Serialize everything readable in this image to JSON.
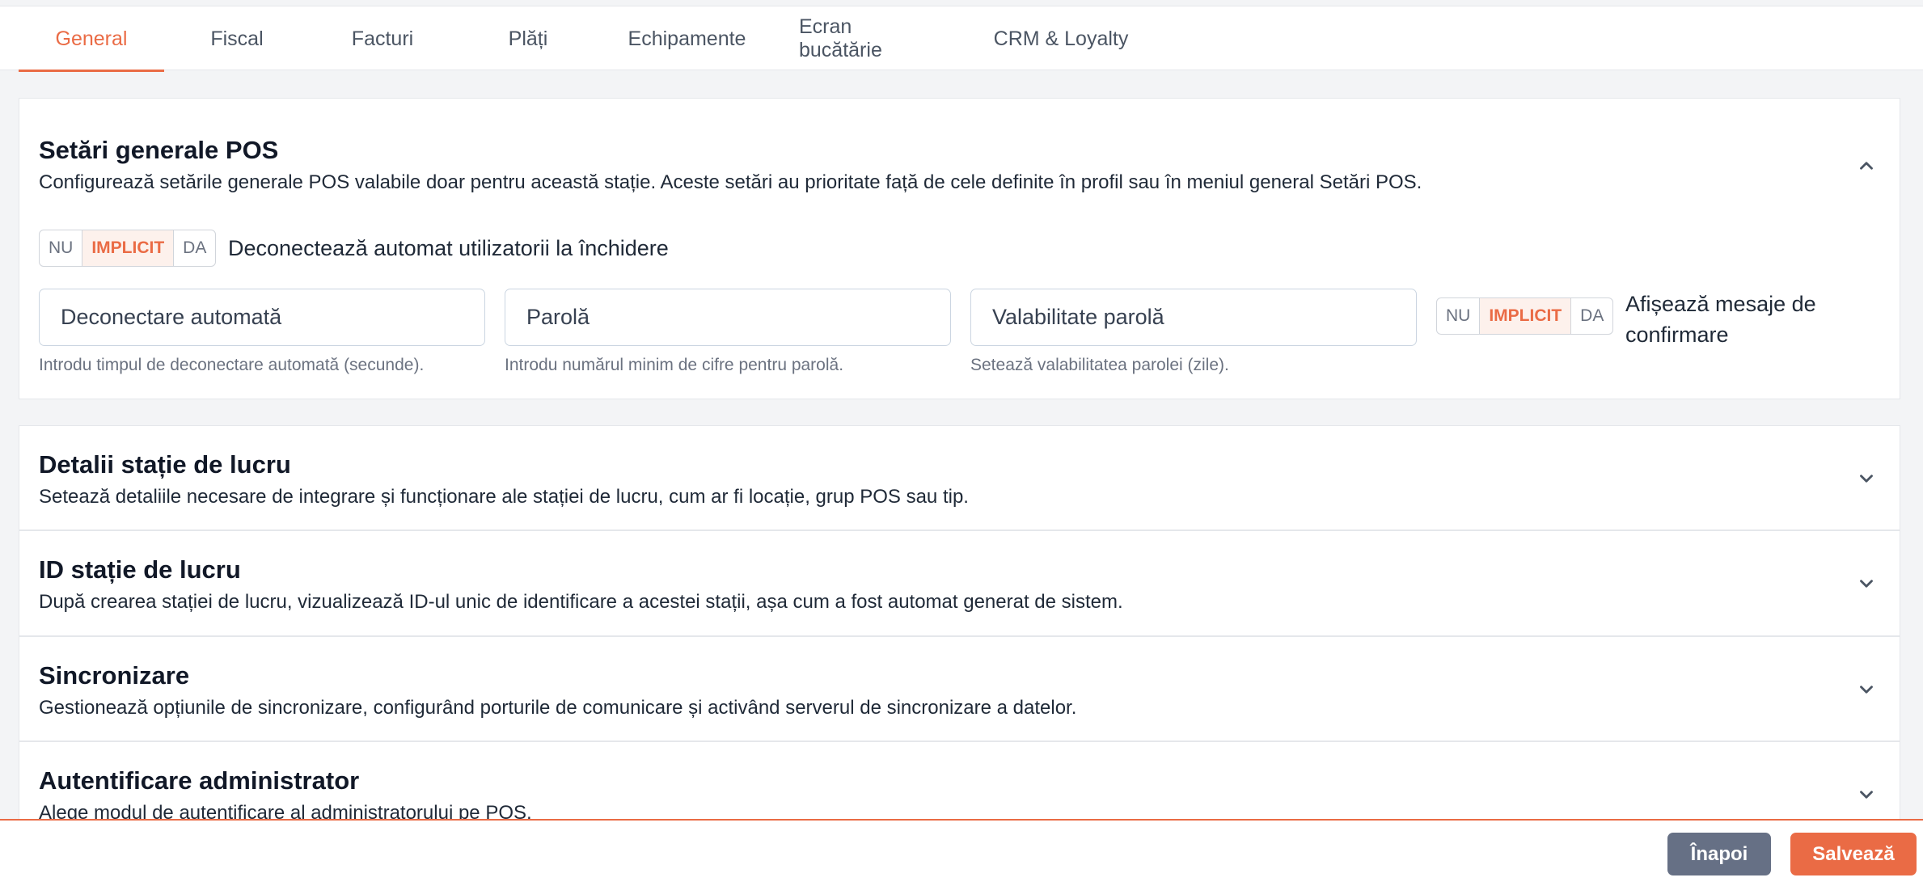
{
  "tabs": [
    "General",
    "Fiscal",
    "Facturi",
    "Plăți",
    "Echipamente",
    "Ecran bucătărie",
    "CRM & Loyalty"
  ],
  "active_tab": "General",
  "toggle_options": {
    "no": "NU",
    "default": "IMPLICIT",
    "yes": "DA"
  },
  "general_section": {
    "title": "Setări generale POS",
    "description": "Configurează setările generale POS valabile doar pentru această stație. Aceste setări au prioritate față de cele definite în profil sau în meniul general Setări POS.",
    "auto_logout_toggle_label": "Deconectează automat utilizatorii la închidere",
    "auto_logout_toggle_value": "IMPLICIT",
    "fields": [
      {
        "placeholder": "Deconectare automată",
        "hint": "Introdu timpul de deconectare automată (secunde)."
      },
      {
        "placeholder": "Parolă",
        "hint": "Introdu numărul minim de cifre pentru parolă."
      },
      {
        "placeholder": "Valabilitate parolă",
        "hint": "Setează valabilitatea parolei (zile)."
      }
    ],
    "confirm_toggle_label": "Afișează mesaje de confirmare",
    "confirm_toggle_value": "IMPLICIT",
    "expanded": true
  },
  "sections": [
    {
      "title": "Detalii stație de lucru",
      "description": "Setează detaliile necesare de integrare și funcționare ale stației de lucru, cum ar fi locație, grup POS sau tip.",
      "expanded": false
    },
    {
      "title": "ID stație de lucru",
      "description": "După crearea stației de lucru, vizualizează ID-ul unic de identificare a acestei stații, așa cum a fost automat generat de sistem.",
      "expanded": false
    },
    {
      "title": "Sincronizare",
      "description": "Gestionează opțiunile de sincronizare, configurând porturile de comunicare și activând serverul de sincronizare a datelor.",
      "expanded": false
    },
    {
      "title": "Autentificare administrator",
      "description": "Alege modul de autentificare al administratorului pe POS.",
      "expanded": false
    }
  ],
  "footer": {
    "back_label": "Înapoi",
    "save_label": "Salvează"
  },
  "colors": {
    "accent": "#ea6b45",
    "back_button": "#667085",
    "background": "#f3f4f6"
  },
  "icons": {
    "collapse": "chevron-up-icon",
    "expand": "chevron-down-icon"
  }
}
